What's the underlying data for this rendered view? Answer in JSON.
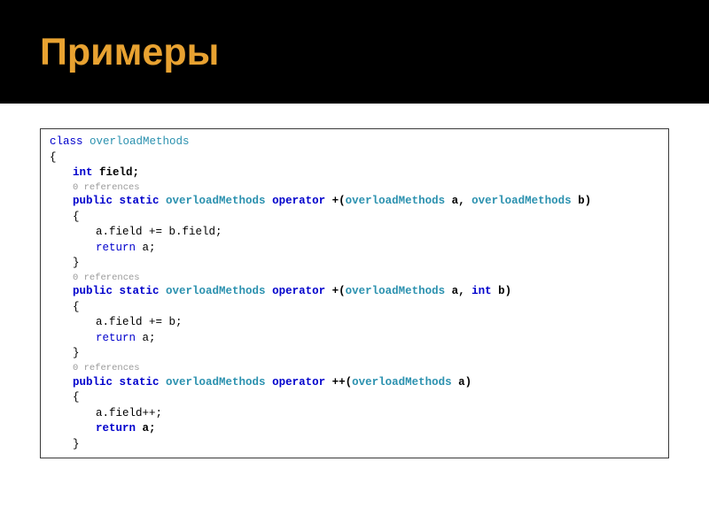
{
  "slide": {
    "title": "Примеры"
  },
  "code": {
    "refs": "0 references",
    "l01_class": "class",
    "l01_type": " overloadMethods",
    "l02": "{",
    "l03_kw": "int",
    "l03_rest": " field;",
    "l05_kw": "public static ",
    "l05_type": "overloadMethods",
    "l05_op": " operator ",
    "l05_plus": "+(",
    "l05_typeA": "overloadMethods",
    "l05_a": " a, ",
    "l05_typeB": "overloadMethods",
    "l05_b": " b)",
    "l06": "{",
    "l07": "a.field += b.field;",
    "l08_kw": "return",
    "l08_rest": " a;",
    "l09": "}",
    "l11_kw": "public static ",
    "l11_type": "overloadMethods",
    "l11_op": " operator ",
    "l11_plus": "+(",
    "l11_typeA": "overloadMethods",
    "l11_a": " a, ",
    "l11_typeB": "int",
    "l11_b": " b)",
    "l12": "{",
    "l13": "a.field += b;",
    "l14_kw": "return",
    "l14_rest": " a;",
    "l15": "}",
    "l17_kw": "public static ",
    "l17_type": "overloadMethods",
    "l17_op": " operator ",
    "l17_plus": "++(",
    "l17_typeA": "overloadMethods",
    "l17_a": " a)",
    "l18": "{",
    "l19": "a.field++;",
    "l20_kw": "return",
    "l20_rest": " a;",
    "l21": "}"
  }
}
